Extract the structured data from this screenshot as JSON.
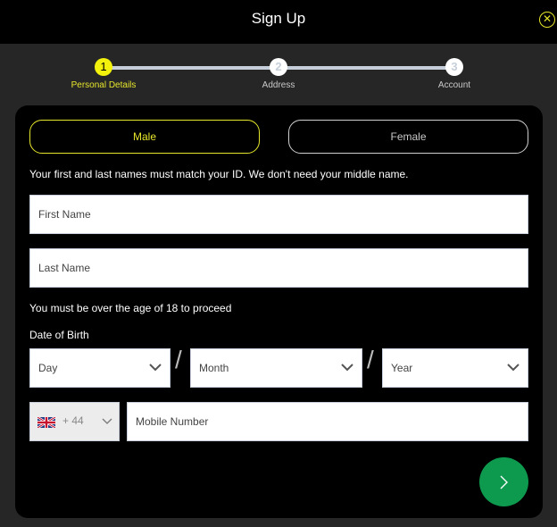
{
  "header": {
    "title": "Sign Up",
    "close_icon": "close-circle-icon"
  },
  "stepper": {
    "steps": [
      {
        "number": "1",
        "label": "Personal Details",
        "active": true
      },
      {
        "number": "2",
        "label": "Address",
        "active": false
      },
      {
        "number": "3",
        "label": "Account",
        "active": false
      }
    ]
  },
  "form": {
    "gender": {
      "male": "Male",
      "female": "Female",
      "selected": "Male"
    },
    "name_note": "Your first and last names must match your ID. We don't need your middle name.",
    "first_name_placeholder": "First Name",
    "last_name_placeholder": "Last Name",
    "age_note": "You must be over the age of 18 to proceed",
    "dob_label": "Date of Birth",
    "dob": {
      "day": "Day",
      "month": "Month",
      "year": "Year",
      "separator": "/"
    },
    "phone": {
      "country_flag": "uk-flag-icon",
      "code": "+ 44",
      "placeholder": "Mobile Number"
    },
    "next_icon": "chevron-right-icon"
  },
  "colors": {
    "accent": "#f2f20c",
    "next_button": "#0d9a4e",
    "background": "#262626"
  }
}
